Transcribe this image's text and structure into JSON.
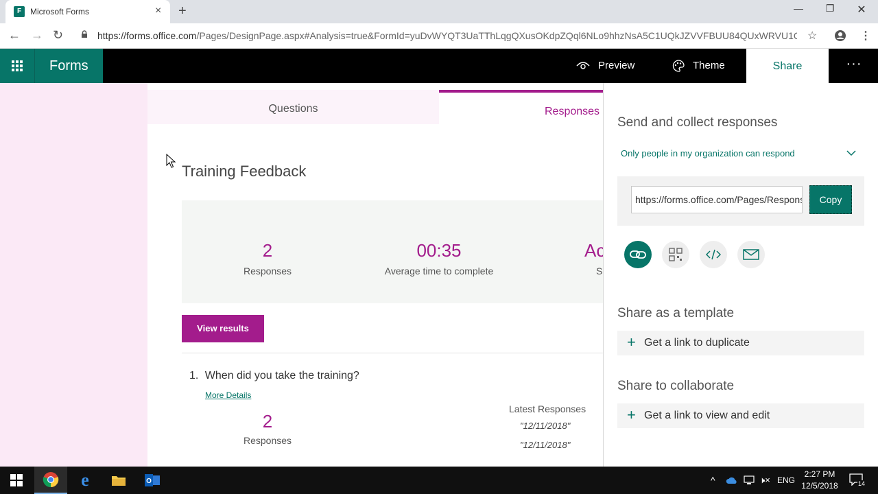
{
  "browser": {
    "tab_title": "Microsoft Forms",
    "favicon_text": "F",
    "url_host": "https://forms.office.com",
    "url_rest": "/Pages/DesignPage.aspx#Analysis=true&FormId=yuDvWYQT3UaTThLqgQXusOKdpZQql6NLo9hhzNsA5C1UQkJZVVFBUU84QUxWRVU1QjF..."
  },
  "header": {
    "app_name": "Forms",
    "preview_label": "Preview",
    "theme_label": "Theme",
    "share_label": "Share"
  },
  "tabs": {
    "questions": "Questions",
    "responses": "Responses"
  },
  "form": {
    "title": "Training Feedback",
    "stats": {
      "responses_value": "2",
      "responses_label": "Responses",
      "avg_time_value": "00:35",
      "avg_time_label": "Average time to complete",
      "status_value": "Ac",
      "status_label": "S"
    },
    "view_results": "View results",
    "question1": {
      "number": "1.",
      "text": "When did you take the training?",
      "more_details": "More Details",
      "count": "2",
      "count_label": "Responses",
      "latest_label": "Latest Responses",
      "latest": [
        "\"12/11/2018\"",
        "\"12/11/2018\""
      ]
    }
  },
  "share_panel": {
    "send_title": "Send and collect responses",
    "audience": "Only people in my organization can respond",
    "link_value": "https://forms.office.com/Pages/ResponsePage.aspx",
    "copy_label": "Copy",
    "template_title": "Share as a template",
    "duplicate_link": "Get a link to duplicate",
    "collaborate_title": "Share to collaborate",
    "view_edit_link": "Get a link to view and edit"
  },
  "taskbar": {
    "lang": "ENG",
    "time": "2:27 PM",
    "date": "12/5/2018",
    "notifications": "14"
  },
  "colors": {
    "forms_green": "#077568",
    "forms_purple": "#a31c8c",
    "left_bg": "#fbe9f6"
  }
}
